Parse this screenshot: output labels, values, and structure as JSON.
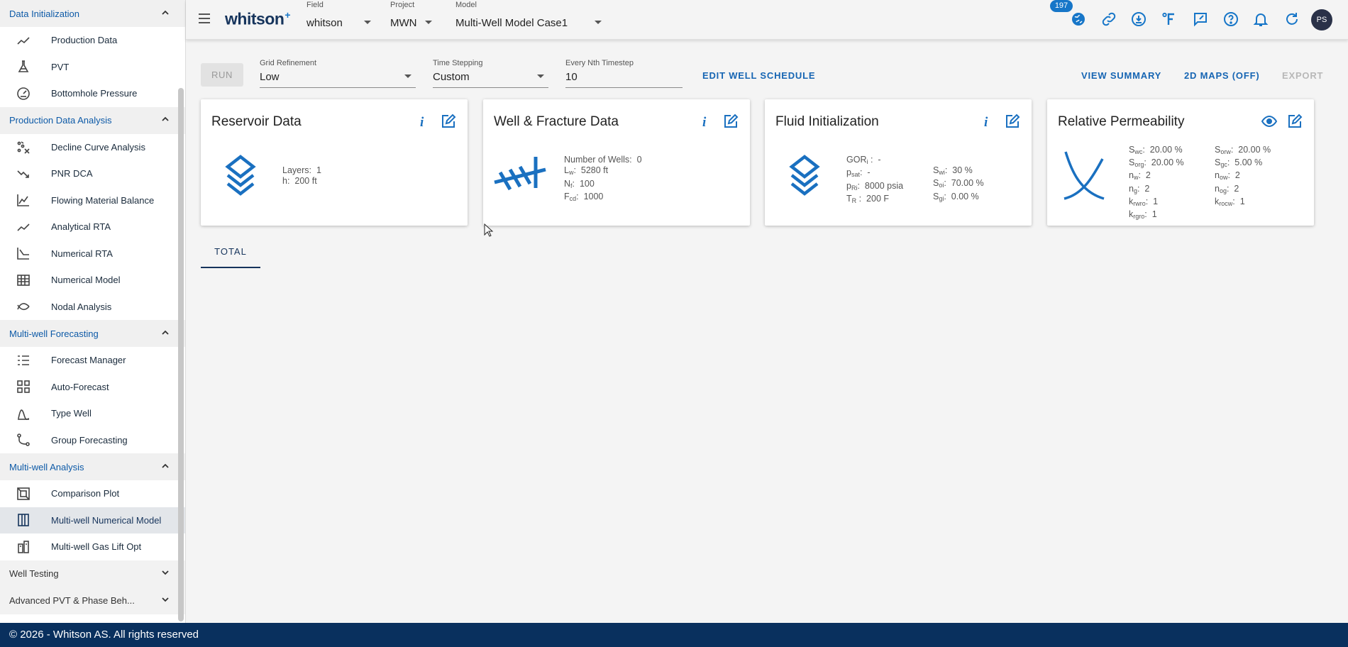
{
  "sidebar": {
    "sections": [
      {
        "label": "Data Initialization",
        "expanded": true,
        "items": [
          {
            "label": "Production Data",
            "icon": "trend-line-icon"
          },
          {
            "label": "PVT",
            "icon": "flask-icon"
          },
          {
            "label": "Bottomhole Pressure",
            "icon": "gauge-icon"
          }
        ]
      },
      {
        "label": "Production Data Analysis",
        "expanded": true,
        "items": [
          {
            "label": "Decline Curve Analysis",
            "icon": "decline-scatter-icon"
          },
          {
            "label": "PNR DCA",
            "icon": "trend-down-icon"
          },
          {
            "label": "Flowing Material Balance",
            "icon": "line-chart-icon"
          },
          {
            "label": "Analytical RTA",
            "icon": "trend-line-icon"
          },
          {
            "label": "Numerical RTA",
            "icon": "curve-chart-icon"
          },
          {
            "label": "Numerical Model",
            "icon": "grid-table-icon"
          },
          {
            "label": "Nodal Analysis",
            "icon": "crossing-curves-icon"
          }
        ]
      },
      {
        "label": "Multi-well Forecasting",
        "expanded": true,
        "items": [
          {
            "label": "Forecast Manager",
            "icon": "list-icon"
          },
          {
            "label": "Auto-Forecast",
            "icon": "dashboard-grid-icon"
          },
          {
            "label": "Type Well",
            "icon": "bell-curve-icon"
          },
          {
            "label": "Group Forecasting",
            "icon": "node-branch-icon"
          }
        ]
      },
      {
        "label": "Multi-well Analysis",
        "expanded": true,
        "items": [
          {
            "label": "Comparison Plot",
            "icon": "compare-frame-icon"
          },
          {
            "label": "Multi-well Numerical Model",
            "icon": "columns-icon",
            "active": true
          },
          {
            "label": "Multi-well Gas Lift Opt",
            "icon": "gas-lift-icon"
          }
        ]
      },
      {
        "label": "Well Testing",
        "expanded": false,
        "items": []
      },
      {
        "label": "Advanced PVT & Phase Beh...",
        "expanded": false,
        "items": []
      }
    ]
  },
  "topbar": {
    "logo": "whitson",
    "logo_sup": "+",
    "field": {
      "label": "Field",
      "value": "whitson"
    },
    "project": {
      "label": "Project",
      "value": "MWN"
    },
    "model": {
      "label": "Model",
      "value": "Multi-Well Model Case1"
    },
    "notifications_count": "197",
    "avatar_initials": "PS",
    "icons": [
      "globe-icon",
      "link-icon",
      "download-icon",
      "fahrenheit-icon",
      "feedback-icon",
      "help-icon",
      "bell-icon",
      "refresh-icon"
    ]
  },
  "toolbar": {
    "run_label": "RUN",
    "grid_refinement": {
      "label": "Grid Refinement",
      "value": "Low"
    },
    "time_stepping": {
      "label": "Time Stepping",
      "value": "Custom"
    },
    "nth_timestep": {
      "label": "Every Nth Timestep",
      "value": "10"
    },
    "edit_well_schedule": "EDIT WELL SCHEDULE",
    "view_summary": "VIEW SUMMARY",
    "maps_2d": "2D MAPS (OFF)",
    "export": "EXPORT"
  },
  "cards": {
    "reservoir": {
      "title": "Reservoir Data",
      "layers_label": "Layers:",
      "layers": "1",
      "h_label": "h:",
      "h": "200 ft"
    },
    "well": {
      "title": "Well & Fracture Data",
      "num_wells_label": "Number of Wells:",
      "num_wells": "0",
      "lw": "5280 ft",
      "nf": "100",
      "fcd": "1000"
    },
    "fluid": {
      "title": "Fluid Initialization",
      "gor": "-",
      "psat": "-",
      "pri": "8000 psia",
      "tr": "200 F",
      "swi": "30 %",
      "soi": "70.00 %",
      "sgi": "0.00 %"
    },
    "relperm": {
      "title": "Relative Permeability",
      "swc": "20.00 %",
      "sorg": "20.00 %",
      "nw": "2",
      "ng": "2",
      "krwro": "1",
      "krgro": "1",
      "sorw": "20.00 %",
      "sgc": "5.00 %",
      "now": "2",
      "nog": "2",
      "krocw": "1"
    }
  },
  "tabs": {
    "total": "TOTAL"
  },
  "footer": {
    "text": "© 2026 - Whitson AS. All rights reserved"
  },
  "colors": {
    "accent": "#1776c8",
    "brand_dark": "#09305e",
    "icon_blue": "#1a70c0"
  }
}
